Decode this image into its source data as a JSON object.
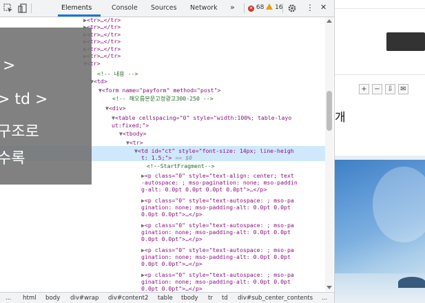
{
  "toolbar": {
    "tabs": [
      "Elements",
      "Console",
      "Sources",
      "Network",
      "»"
    ],
    "errors": "68",
    "warnings": "16",
    "more": "⋮",
    "close": "✕"
  },
  "overlay": {
    "lines": [
      ">",
      "> td >",
      "구조로",
      "수록"
    ]
  },
  "tree": {
    "lines": [
      "<tr>…</tr>",
      "<tr>…</tr>",
      "<tr>…</tr>",
      "<tr>…</tr>",
      "<tr>…</tr>",
      "<tr>…</tr>",
      "<tr>",
      "<!-- 내용 -->",
      "<td>",
      "<form name=\"payform\" method=\"post\">",
      "<!-- 해오름본문고정광고300-250 -->",
      "<div>",
      "<table cellspacing=\"0\" style=\"width:100%; table-layo",
      "ut:fixed;\">",
      "<tbody>",
      "<tr>",
      "<td id=\"ct\" style=\"font-size: 14px; line-heigh",
      "t: 1.5;\">",
      "== $0",
      "<!--StartFragment-->",
      "<p class=\"0\" style=\"text-align: center; text",
      "-autospace: ; mso-pagination: none; mso-paddin",
      "g-alt: 0.0pt 0.0pt 0.0pt 0.0pt\">…</p>",
      "<p class=\"0\" style=\"text-autospace: ; mso-pa",
      "gination: none; mso-padding-alt: 0.0pt 0.0pt",
      "0.0pt 0.0pt\">…</p>",
      "<p class=\"0\" style=\"text-autospace: ; mso-pa",
      "gination: none; mso-padding-alt: 0.0pt 0.0pt",
      "0.0pt 0.0pt\">…</p>",
      "<p class=\"0\" style=\"text-autospace: ; mso-pa",
      "gination: none; mso-padding-alt: 0.0pt 0.0pt",
      "0.0pt 0.0pt\">…</p>",
      "<p class=\"0\" style=\"text-autospace: ; mso-pa",
      "gination: none; mso-padding-alt: 0.0pt 0.0pt",
      "0.0pt 0.0pt\">…</p>",
      "<p class=\"0\" style=\"text-autospace: ; mso-pa",
      "gination: none; mso-padding-alt: 0.0pt 0.0pt",
      "0.0pt 0.0pt\">…</p>"
    ]
  },
  "breadcrumbs": [
    "...",
    "html",
    "body",
    "div#wrap",
    "div#content2",
    "table",
    "tbody",
    "tr",
    "td",
    "div#sub_center_contents",
    "..."
  ],
  "page": {
    "title": "개",
    "buttons": [
      "+",
      "−",
      "⇩",
      "✉"
    ]
  },
  "colors": {
    "selection": "#cfe8fc",
    "tag": "#881280",
    "attr_name": "#994500",
    "attr_value": "#1a1aa6",
    "comment": "#236e25",
    "tab_accent": "#1a73e8"
  }
}
